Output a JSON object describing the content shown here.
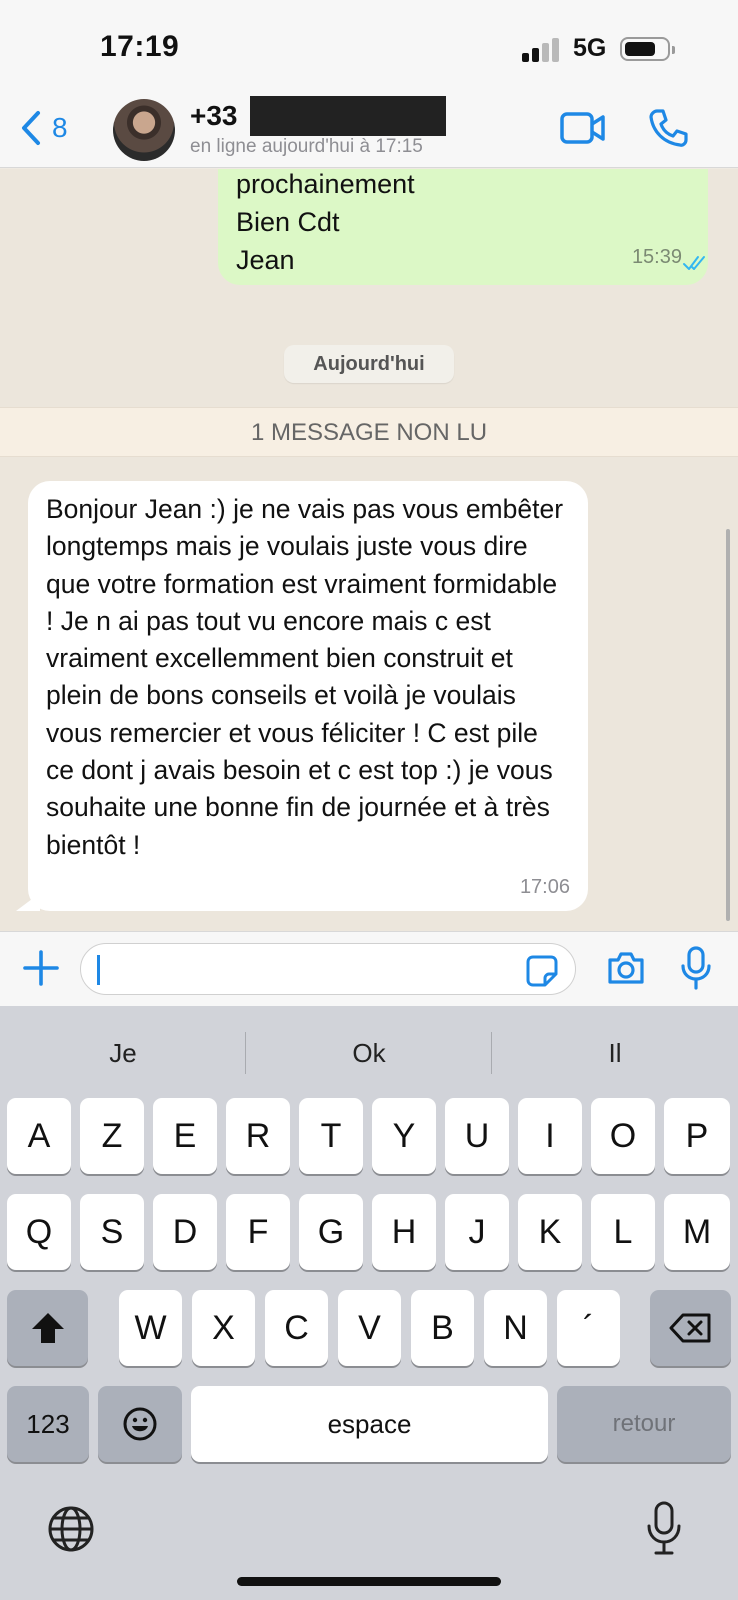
{
  "status_bar": {
    "time": "17:19",
    "network": "5G"
  },
  "header": {
    "back_count": "8",
    "contact_name": "+33",
    "contact_status": "en ligne aujourd'hui à 17:15",
    "icons": [
      "chevron-left-icon",
      "video-call-icon",
      "phone-icon"
    ]
  },
  "chat": {
    "outgoing": {
      "lines": [
        "prochainement",
        "Bien Cdt",
        "Jean"
      ],
      "time": "15:39",
      "read_ticks_color": "#34b7f1"
    },
    "day_separator": "Aujourd'hui",
    "unread_banner": "1 MESSAGE NON LU",
    "incoming": {
      "text": "Bonjour Jean :) je ne vais pas vous embêter longtemps mais je voulais juste vous dire que votre formation est vraiment formidable ! Je n ai pas tout vu encore mais c est vraiment excellemment bien construit et plein de bons conseils et voilà je voulais vous remercier et vous féliciter ! C est pile ce dont j avais besoin et c est top :) je vous souhaite une bonne fin de journée et à très bientôt !",
      "time": "17:06"
    }
  },
  "composer": {
    "value": "",
    "icons": [
      "plus-icon",
      "sticker-icon",
      "camera-icon",
      "microphone-icon"
    ]
  },
  "keyboard": {
    "suggestions": [
      "Je",
      "Ok",
      "Il"
    ],
    "row1": [
      "A",
      "Z",
      "E",
      "R",
      "T",
      "Y",
      "U",
      "I",
      "O",
      "P"
    ],
    "row2": [
      "Q",
      "S",
      "D",
      "F",
      "G",
      "H",
      "J",
      "K",
      "L",
      "M"
    ],
    "row3": [
      "W",
      "X",
      "C",
      "V",
      "B",
      "N",
      "´"
    ],
    "numbers_key": "123",
    "space_key": "espace",
    "return_key": "retour"
  },
  "colors": {
    "accent": "#1e88e5",
    "outgoing_bubble": "#dcf8c6",
    "incoming_bubble": "#ffffff",
    "chat_bg": "#ece6dc"
  }
}
